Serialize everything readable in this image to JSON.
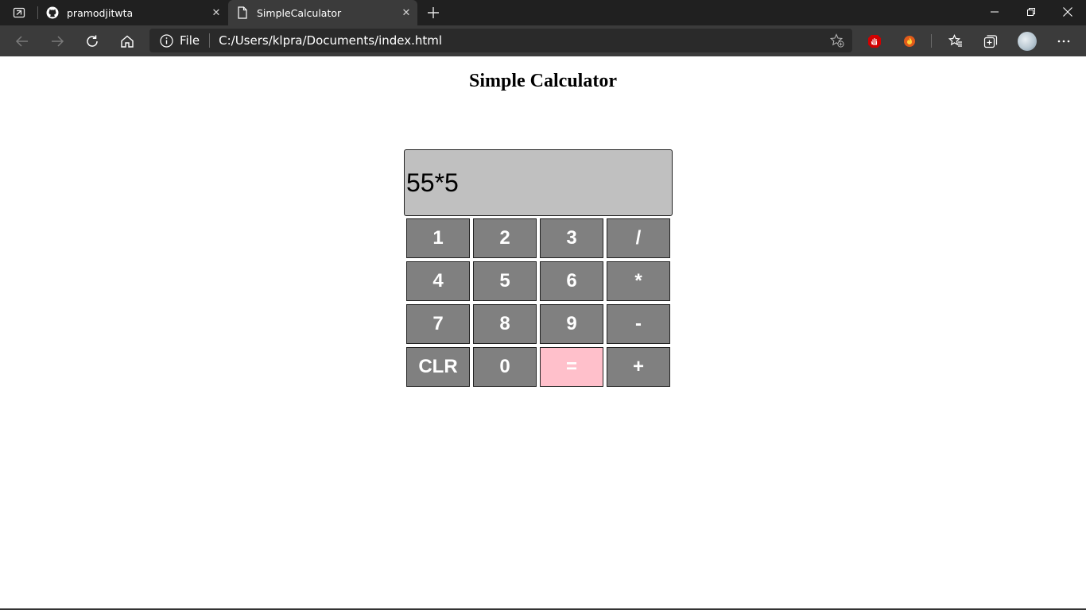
{
  "browser": {
    "tabs": [
      {
        "title": "pramodjitwta",
        "icon": "github-icon",
        "active": false
      },
      {
        "title": "SimpleCalculator",
        "icon": "page-icon",
        "active": true
      }
    ],
    "address": {
      "scheme_label": "File",
      "url": "C:/Users/klpra/Documents/index.html"
    },
    "colors": {
      "tabbar_bg": "#202020",
      "toolbar_bg": "#3b3b3b",
      "omnibox_bg": "#2a2a2a"
    }
  },
  "page": {
    "heading": "Simple Calculator",
    "display_value": "55*5",
    "keys": [
      {
        "label": "1",
        "name": "key-1"
      },
      {
        "label": "2",
        "name": "key-2"
      },
      {
        "label": "3",
        "name": "key-3"
      },
      {
        "label": "/",
        "name": "key-divide"
      },
      {
        "label": "4",
        "name": "key-4"
      },
      {
        "label": "5",
        "name": "key-5"
      },
      {
        "label": "6",
        "name": "key-6"
      },
      {
        "label": "*",
        "name": "key-multiply"
      },
      {
        "label": "7",
        "name": "key-7"
      },
      {
        "label": "8",
        "name": "key-8"
      },
      {
        "label": "9",
        "name": "key-9"
      },
      {
        "label": "-",
        "name": "key-subtract"
      },
      {
        "label": "CLR",
        "name": "key-clear"
      },
      {
        "label": "0",
        "name": "key-0"
      },
      {
        "label": "=",
        "name": "key-equals"
      },
      {
        "label": "+",
        "name": "key-add"
      }
    ],
    "colors": {
      "display_bg": "#c0c0c0",
      "key_bg": "#808080",
      "equals_bg": "#ffc0cb",
      "key_text": "#ffffff"
    }
  }
}
